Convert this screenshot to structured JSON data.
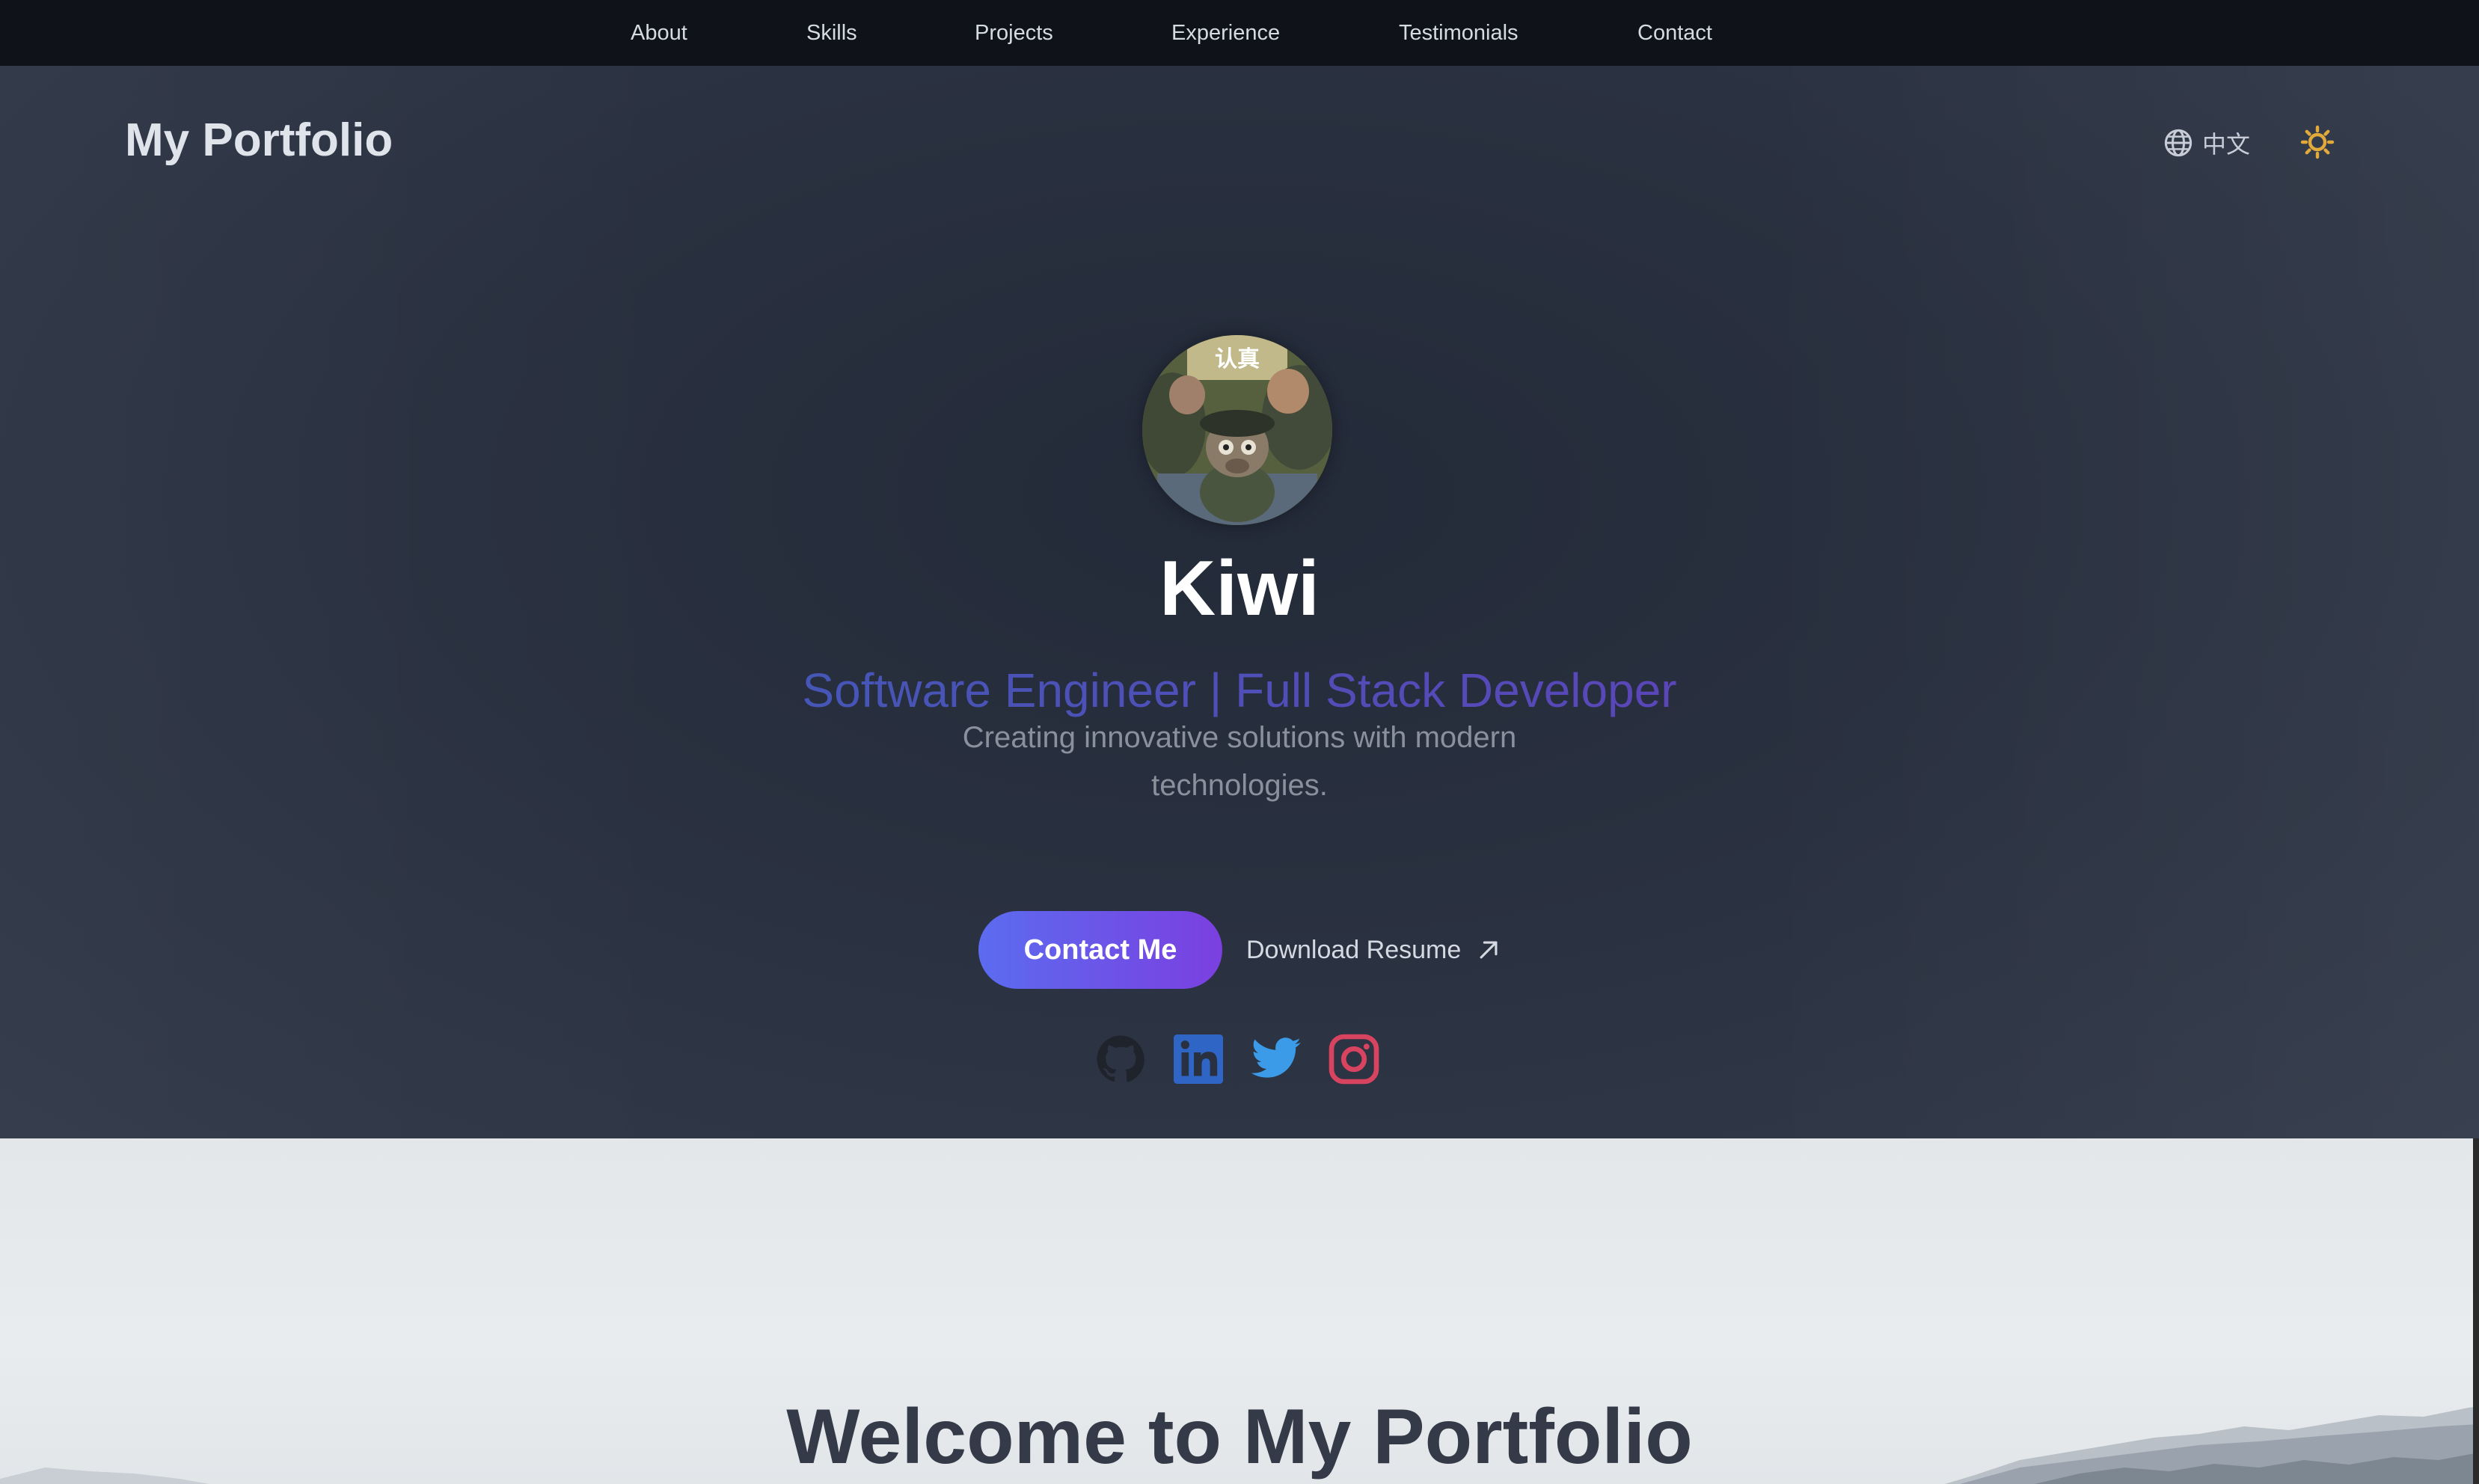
{
  "nav": {
    "items": [
      {
        "label": "About"
      },
      {
        "label": "Skills"
      },
      {
        "label": "Projects"
      },
      {
        "label": "Experience"
      },
      {
        "label": "Testimonials"
      },
      {
        "label": "Contact"
      }
    ]
  },
  "header": {
    "logo": "My Portfolio",
    "language_label": "中文",
    "language_icon": "globe-icon",
    "theme_icon": "sun-icon",
    "theme_color": "#e2a93b"
  },
  "hero": {
    "avatar_caption": "认真",
    "name": "Kiwi",
    "role": "Software Engineer | Full Stack Developer",
    "tagline": "Creating innovative solutions with modern technologies.",
    "contact_button": "Contact Me",
    "resume_link": "Download Resume",
    "socials": [
      {
        "name": "github",
        "icon": "github-icon",
        "color": "#1f232b"
      },
      {
        "name": "linkedin",
        "icon": "linkedin-icon",
        "color": "#2f66c6"
      },
      {
        "name": "twitter",
        "icon": "twitter-icon",
        "color": "#3b9be8"
      },
      {
        "name": "instagram",
        "icon": "instagram-icon",
        "color": "#d8445f"
      }
    ]
  },
  "welcome": {
    "title": "Welcome to My Portfolio"
  },
  "colors": {
    "accent_start": "#5b6cf0",
    "accent_end": "#7b3fe0",
    "nav_bg": "#0f1219",
    "hero_bg": "#29303f"
  }
}
